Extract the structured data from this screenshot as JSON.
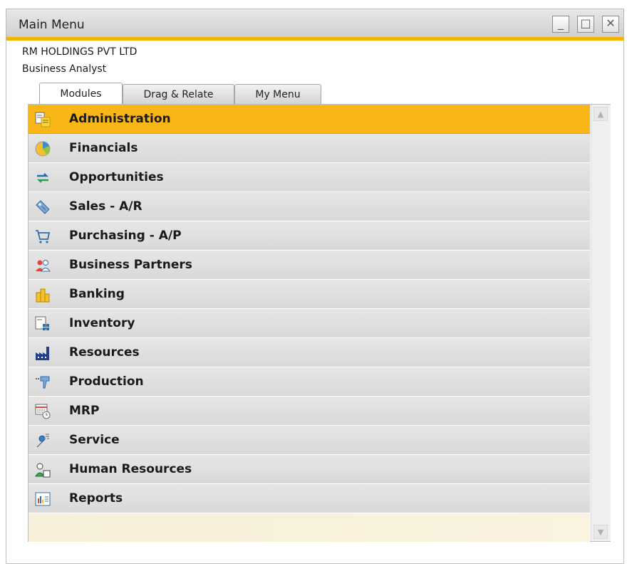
{
  "window": {
    "title": "Main Menu",
    "minimize_label": "_",
    "maximize_label": "□",
    "close_label": "✕"
  },
  "header": {
    "company": "RM HOLDINGS PVT LTD",
    "role": "Business Analyst"
  },
  "tabs": [
    {
      "label": "Modules",
      "active": true
    },
    {
      "label": "Drag & Relate",
      "active": false
    },
    {
      "label": "My Menu",
      "active": false
    }
  ],
  "modules": [
    {
      "label": "Administration",
      "icon": "administration-icon",
      "selected": true
    },
    {
      "label": "Financials",
      "icon": "financials-pie-icon",
      "selected": false
    },
    {
      "label": "Opportunities",
      "icon": "opportunities-icon",
      "selected": false
    },
    {
      "label": "Sales - A/R",
      "icon": "sales-tag-icon",
      "selected": false
    },
    {
      "label": "Purchasing - A/P",
      "icon": "shopping-cart-icon",
      "selected": false
    },
    {
      "label": "Business Partners",
      "icon": "business-partners-icon",
      "selected": false
    },
    {
      "label": "Banking",
      "icon": "banking-coins-icon",
      "selected": false
    },
    {
      "label": "Inventory",
      "icon": "inventory-icon",
      "selected": false
    },
    {
      "label": "Resources",
      "icon": "resources-factory-icon",
      "selected": false
    },
    {
      "label": "Production",
      "icon": "production-icon",
      "selected": false
    },
    {
      "label": "MRP",
      "icon": "mrp-icon",
      "selected": false
    },
    {
      "label": "Service",
      "icon": "service-wrench-icon",
      "selected": false
    },
    {
      "label": "Human Resources",
      "icon": "human-resources-icon",
      "selected": false
    },
    {
      "label": "Reports",
      "icon": "reports-icon",
      "selected": false
    }
  ],
  "colors": {
    "accent": "#f8b716",
    "row": "#dedede"
  }
}
